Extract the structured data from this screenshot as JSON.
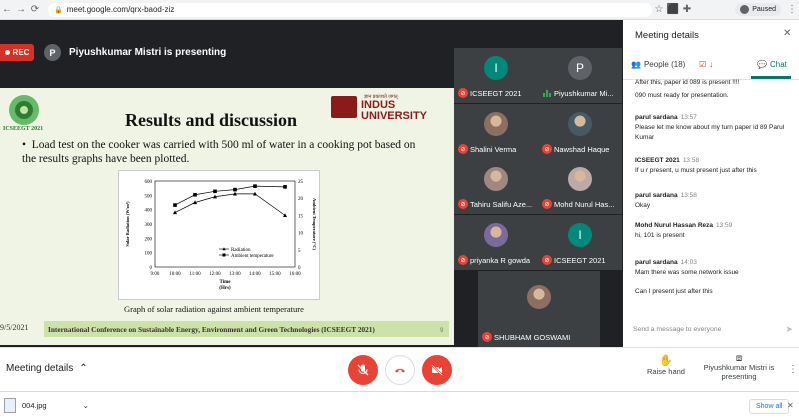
{
  "browser": {
    "url": "meet.google.com/qrx-baod-ziz",
    "paused_label": "Paused"
  },
  "stage": {
    "rec_label": "REC",
    "presenter_initial": "P",
    "presenter_banner": "Piyushkumar Mistri is presenting"
  },
  "slide": {
    "logo_caption": "ICSEEGT 2021",
    "title": "Results and discussion",
    "university_tagline": "ज्ञान प्रकाशते जगत्",
    "university_name": "INDUS UNIVERSITY",
    "bullet": "Load test on the cooker was carried with 500 ml of water in a cooking pot based on the results graphs have been plotted.",
    "caption": "Graph of solar radiation against ambient temperature",
    "date_fragment": "9/5/2021",
    "conference": "International Conference on Sustainable Energy, Environment and Green Technologies (ICSEEGT 2021)",
    "page_number": "9"
  },
  "chart_data": {
    "type": "line",
    "x": [
      "9:00",
      "10:00",
      "11:00",
      "12:00",
      "13:00",
      "14:00",
      "15:00",
      "16:00"
    ],
    "xlabel": "Time (Hrs)",
    "ylabel_left": "Solar Radiation (W/m²)",
    "ylabel_right": "Ambient Temperature (°C)",
    "yticks_left": [
      "0",
      "100",
      "200",
      "300",
      "400",
      "500",
      "600"
    ],
    "yticks_right": [
      "0",
      "5",
      "10",
      "15",
      "20",
      "25"
    ],
    "ylim_left": [
      0,
      600
    ],
    "ylim_right": [
      0,
      25
    ],
    "xlim": [
      9,
      16
    ],
    "series": [
      {
        "name": "Radiation",
        "axis": "left",
        "marker": "triangle",
        "x": [
          10,
          11,
          12,
          13,
          14,
          15.5
        ],
        "values": [
          380,
          450,
          490,
          510,
          510,
          360
        ]
      },
      {
        "name": "Ambient temperature",
        "axis": "right",
        "marker": "square",
        "x": [
          10,
          11,
          12,
          13,
          14,
          15.5
        ],
        "values": [
          18,
          21,
          22,
          22.5,
          23.5,
          23.3
        ]
      }
    ]
  },
  "participants": [
    {
      "name": "ICSEEGT 2021",
      "initial": "I",
      "avatar_color": "#00897b",
      "muted": true
    },
    {
      "name": "Piyushkumar Mi...",
      "initial": "P",
      "avatar_color": "#5f6368",
      "muted": false
    },
    {
      "name": "Shalini Verma",
      "photo_color": "#8d6e63",
      "muted": true
    },
    {
      "name": "Nawshad Haque",
      "photo_color": "#455a64",
      "muted": true
    },
    {
      "name": "Tahiru Salifu Aze...",
      "photo_color": "#a1887f",
      "muted": true
    },
    {
      "name": "Mohd Nurul Has...",
      "photo_color": "#bcaaa4",
      "muted": true
    },
    {
      "name": "priyanka R gowda",
      "photo_color": "#7b6a9e",
      "muted": true
    },
    {
      "name": "ICSEEGT 2021",
      "initial": "I",
      "avatar_color": "#00897b",
      "muted": true
    },
    {
      "name": "SHUBHAM GOSWAMI",
      "photo_color": "#8d6e63",
      "muted": true
    }
  ],
  "panel": {
    "title": "Meeting details",
    "people_tab": "People (18)",
    "chat_tab": "Chat",
    "messages": [
      {
        "text": "After this, paper id 089 is present !!!!"
      },
      {
        "text": "090 must ready for presentation."
      },
      {
        "sender": "parul sardana",
        "time": "13:57",
        "text": "Please let me know about my turn paper id 89 Parul Kumar"
      },
      {
        "sender": "ICSEEGT 2021",
        "time": "13:58",
        "text": "If u r present, u must present just after this"
      },
      {
        "sender": "parul sardana",
        "time": "13:58",
        "text": "Okay"
      },
      {
        "sender": "Mohd Nurul Hassan Reza",
        "time": "13:59",
        "text": "hi, 101 is present"
      },
      {
        "sender": "parul sardana",
        "time": "14:03",
        "text": "Mam there was some network issue"
      },
      {
        "text": "Can I present just after this"
      }
    ],
    "input_placeholder": "Send a message to everyone"
  },
  "bottombar": {
    "meeting_details": "Meeting details",
    "raise_hand": "Raise hand",
    "presenting_now": "Piyushkumar Mistri is presenting"
  },
  "downloads": {
    "file": "004.jpg",
    "show_all": "Show all"
  },
  "colors": {
    "red": "#ea4335",
    "teal": "#00796b",
    "stage": "#202124",
    "tile": "#3c4043",
    "slide_band": "#cde2a8"
  }
}
